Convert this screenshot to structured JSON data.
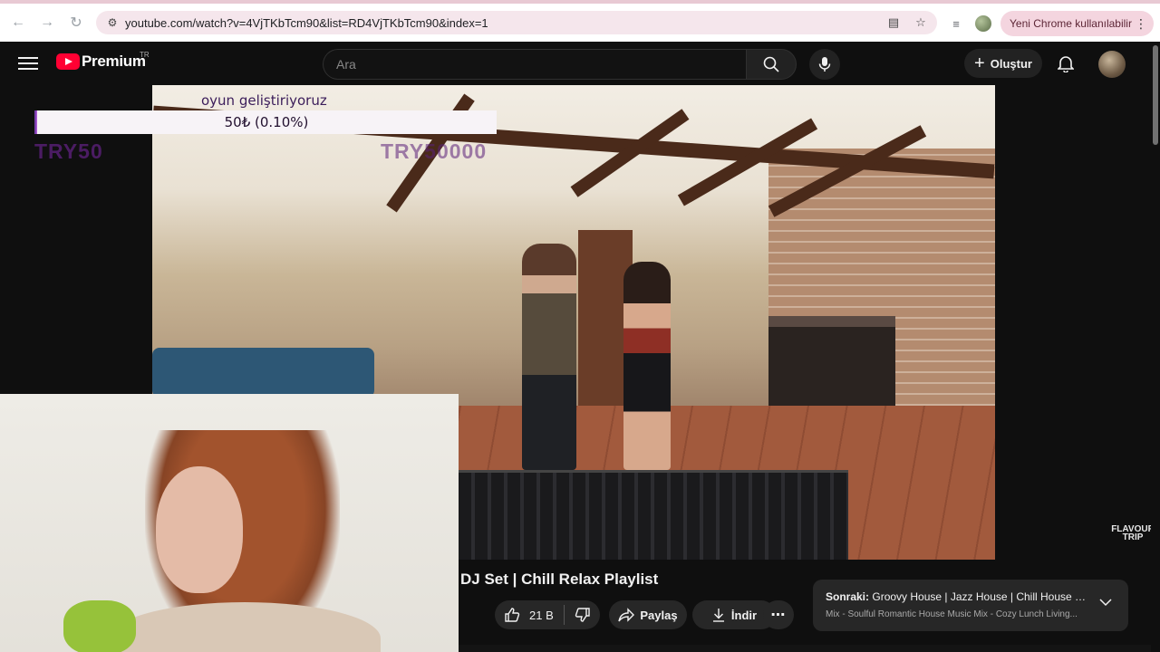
{
  "browser": {
    "url": "youtube.com/watch?v=4VjTKbTcm90&list=RD4VjTKbTcm90&index=1",
    "chrome_notice": "Yeni Chrome kullanılabilir"
  },
  "header": {
    "logo_text": "Premium",
    "logo_region": "TR",
    "search_placeholder": "Ara",
    "create_label": "Oluştur"
  },
  "donation": {
    "title": "oyun geliştiriyoruz",
    "progress_text": "50₺ (0.10%)",
    "progress_percent": 0.1,
    "min_label": "TRY50",
    "max_label": "TRY50000"
  },
  "video": {
    "title": "DJ Set | Chill Relax Playlist",
    "watermark": "FLAVOUR TRIP",
    "likes": "21 B",
    "share_label": "Paylaş",
    "download_label": "İndir"
  },
  "up_next": {
    "prefix": "Sonraki:",
    "title": "Groovy House | Jazz House | Chill House s...",
    "subtitle": "Mix - Soulful Romantic House Music Mix - Cozy Lunch Living..."
  },
  "colors": {
    "brand_red": "#ff0033",
    "donation_purple": "#b05bd6",
    "chrome_notice_bg": "#f4d5df"
  }
}
